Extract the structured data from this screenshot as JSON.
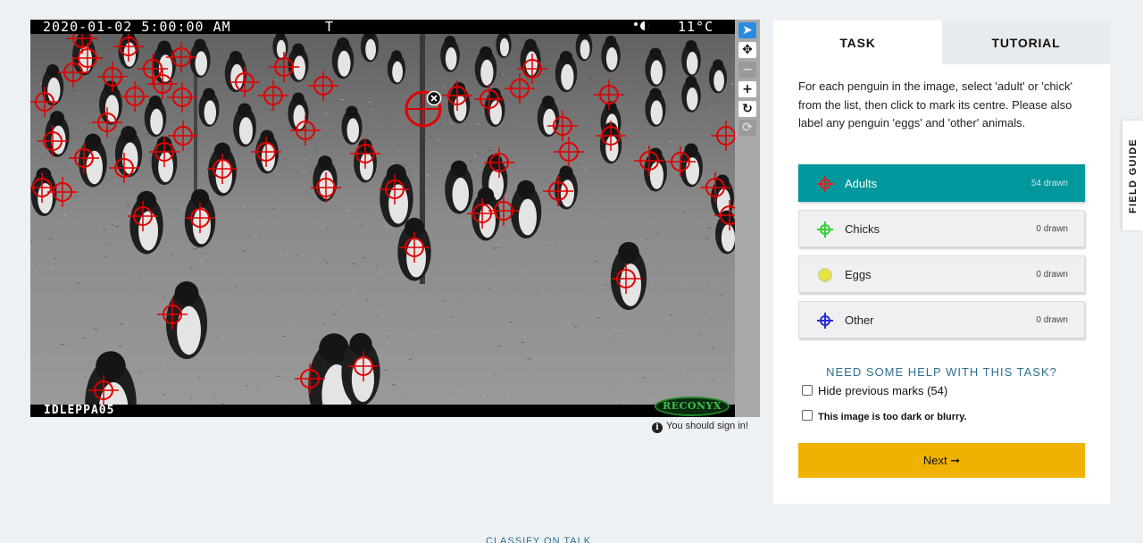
{
  "camera": {
    "timestamp": "2020-01-02  5:00:00 AM",
    "moon_mark": "T",
    "phase_icon": "moon-phase-icon",
    "temperature": "11°C",
    "camera_id": "IDLEPPA05",
    "brand": "RECONYX"
  },
  "toolbar": [
    {
      "name": "annotate-tool",
      "glyph": "➤",
      "state": "active"
    },
    {
      "name": "move-tool",
      "glyph": "✥",
      "state": "normal"
    },
    {
      "name": "zoom-out-tool",
      "glyph": "−",
      "state": "disabled"
    },
    {
      "name": "zoom-in-tool",
      "glyph": "+",
      "state": "normal"
    },
    {
      "name": "rotate-tool",
      "glyph": "↻",
      "state": "normal"
    },
    {
      "name": "reset-tool",
      "glyph": "⟳",
      "state": "disabled"
    }
  ],
  "signin_notice": "You should sign in!",
  "tabs": {
    "task": "TASK",
    "tutorial": "TUTORIAL"
  },
  "instructions": "For each penguin in the image, select 'adult' or 'chick' from the list, then click to mark its centre. Please also label any penguin 'eggs' and 'other' animals.",
  "tools": [
    {
      "label": "Adults",
      "count": "54 drawn",
      "color": "#d62626",
      "icon": "crosshair-icon",
      "selected": true
    },
    {
      "label": "Chicks",
      "count": "0 drawn",
      "color": "#35d135",
      "icon": "crosshair-icon",
      "selected": false
    },
    {
      "label": "Eggs",
      "count": "0 drawn",
      "color": "#e6e33a",
      "icon": "circle-icon",
      "selected": false
    },
    {
      "label": "Other",
      "count": "0 drawn",
      "color": "#2a2ad8",
      "icon": "crosshair-icon",
      "selected": false
    }
  ],
  "help_text": "NEED SOME HELP WITH THIS TASK?",
  "checkboxes": {
    "hide_marks": {
      "label": "Hide previous marks (54)",
      "checked": false
    },
    "too_dark": {
      "label": "This image is too dark or blurry.",
      "checked": false
    }
  },
  "next_label": "Next ➞",
  "field_guide": "FIELD GUIDE",
  "footer_link": "CLASSIFY ON TALK"
}
